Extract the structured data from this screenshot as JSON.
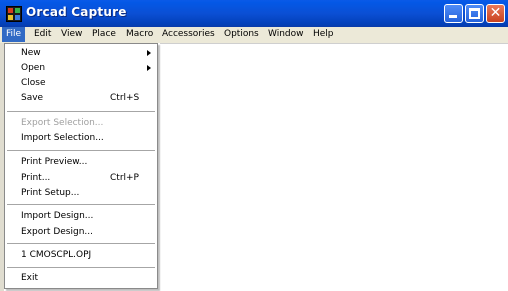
{
  "window": {
    "title": "Orcad Capture"
  },
  "menubar": {
    "items": [
      {
        "label": "File"
      },
      {
        "label": "Edit"
      },
      {
        "label": "View"
      },
      {
        "label": "Place"
      },
      {
        "label": "Macro"
      },
      {
        "label": "Accessories"
      },
      {
        "label": "Options"
      },
      {
        "label": "Window"
      },
      {
        "label": "Help"
      }
    ]
  },
  "file_menu": {
    "new": {
      "label": "New"
    },
    "open": {
      "label": "Open"
    },
    "close": {
      "label": "Close"
    },
    "save": {
      "label": "Save",
      "shortcut": "Ctrl+S"
    },
    "export_selection": {
      "label": "Export Selection..."
    },
    "import_selection": {
      "label": "Import Selection..."
    },
    "print_preview": {
      "label": "Print Preview..."
    },
    "print": {
      "label": "Print...",
      "shortcut": "Ctrl+P"
    },
    "print_setup": {
      "label": "Print Setup..."
    },
    "import_design": {
      "label": "Import Design..."
    },
    "export_design": {
      "label": "Export Design..."
    },
    "recent_1": {
      "label": "1 CMOSCPL.OPJ"
    },
    "exit": {
      "label": "Exit"
    }
  }
}
